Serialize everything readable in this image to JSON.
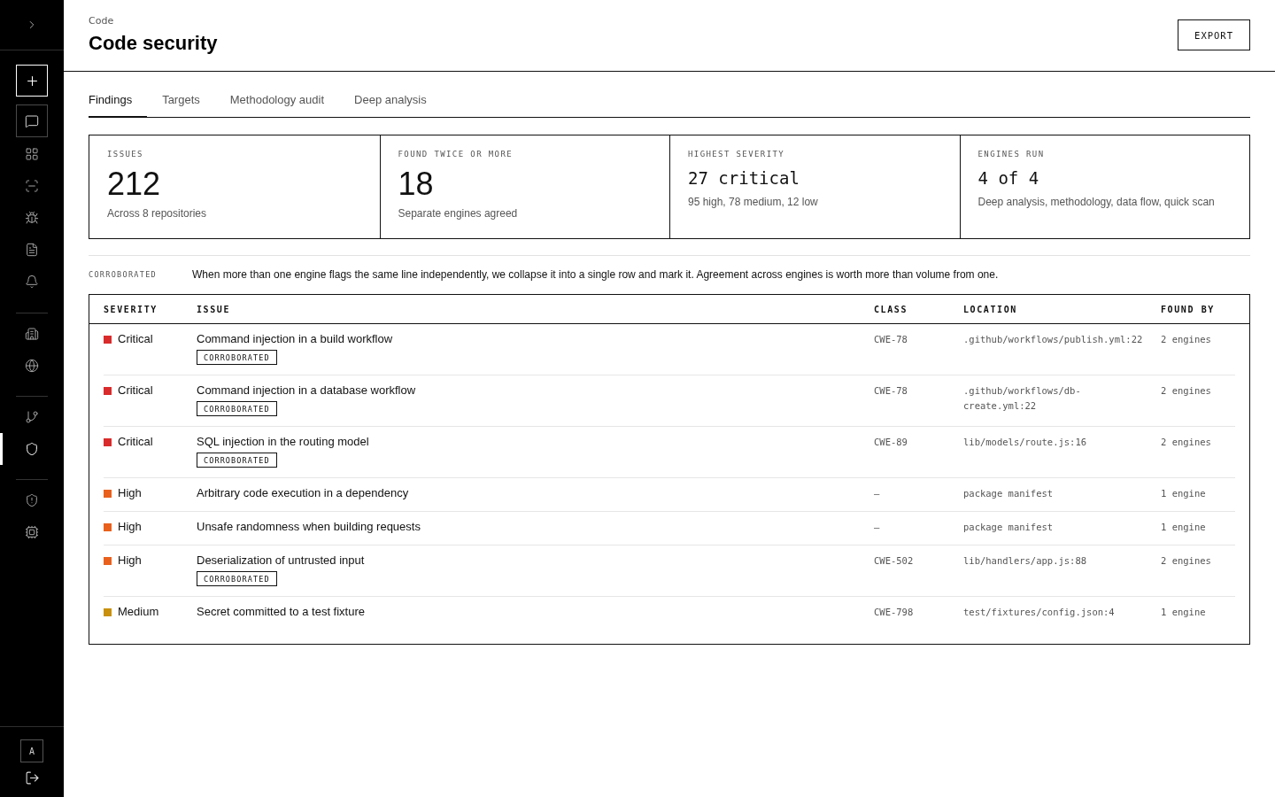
{
  "sidebar": {
    "groups": [
      {
        "items": [
          {
            "kind": "primary",
            "selected": false
          },
          {
            "kind": "framed",
            "selected": false
          },
          {
            "kind": "plain",
            "selected": false
          },
          {
            "kind": "plain",
            "selected": false
          },
          {
            "kind": "plain",
            "selected": false
          },
          {
            "kind": "plain",
            "selected": false
          },
          {
            "kind": "plain",
            "selected": false
          }
        ]
      },
      {
        "items": [
          {
            "kind": "plain",
            "selected": false
          },
          {
            "kind": "plain",
            "selected": false
          }
        ]
      },
      {
        "items": [
          {
            "kind": "plain",
            "selected": false
          },
          {
            "kind": "plain",
            "selected": true
          }
        ]
      },
      {
        "items": [
          {
            "kind": "plain",
            "selected": false
          },
          {
            "kind": "plain",
            "selected": false
          }
        ]
      }
    ],
    "avatar": {
      "initial": "A"
    }
  },
  "header": {
    "breadcrumb": "Code",
    "title": "Code security",
    "action": "EXPORT"
  },
  "tabs": [
    {
      "label": "Findings",
      "selected": true
    },
    {
      "label": "Targets",
      "selected": false
    },
    {
      "label": "Methodology audit",
      "selected": false
    },
    {
      "label": "Deep analysis",
      "selected": false
    }
  ],
  "stats": [
    {
      "kind": "number",
      "label": "ISSUES",
      "value": "212",
      "detail": "Across 8 repositories"
    },
    {
      "kind": "number",
      "label": "FOUND TWICE OR MORE",
      "value": "18",
      "detail": "Separate engines agreed"
    },
    {
      "kind": "phrase",
      "label": "HIGHEST SEVERITY",
      "value": "27 critical",
      "detail": "95 high, 78 medium, 12 low"
    },
    {
      "kind": "phrase",
      "label": "ENGINES RUN",
      "value": "4 of 4",
      "detail": "Deep analysis, methodology, data flow, quick scan"
    }
  ],
  "note": {
    "label": "CORROBORATED",
    "text": "When more than one engine flags the same line independently, we collapse it into a single row and mark it. Agreement across engines is worth more than volume from one."
  },
  "table": {
    "columns": [
      "SEVERITY",
      "ISSUE",
      "CLASS",
      "LOCATION",
      "FOUND BY"
    ],
    "rows": [
      {
        "severity": "Critical",
        "color": "#d92b2b",
        "issue": "Command injection in a build workflow",
        "badge": "CORROBORATED",
        "class": "CWE-78",
        "location": ".github/workflows/publish.yml:22",
        "found_by": "2 engines"
      },
      {
        "severity": "Critical",
        "color": "#d92b2b",
        "issue": "Command injection in a database workflow",
        "badge": "CORROBORATED",
        "class": "CWE-78",
        "location": ".github/workflows/db-create.yml:22",
        "found_by": "2 engines"
      },
      {
        "severity": "Critical",
        "color": "#d92b2b",
        "issue": "SQL injection in the routing model",
        "badge": "CORROBORATED",
        "class": "CWE-89",
        "location": "lib/models/route.js:16",
        "found_by": "2 engines"
      },
      {
        "severity": "High",
        "color": "#e8601c",
        "issue": "Arbitrary code execution in a dependency",
        "class": "—",
        "location": "package manifest",
        "found_by": "1 engine"
      },
      {
        "severity": "High",
        "color": "#e8601c",
        "issue": "Unsafe randomness when building requests",
        "class": "—",
        "location": "package manifest",
        "found_by": "1 engine"
      },
      {
        "severity": "High",
        "color": "#e8601c",
        "issue": "Deserialization of untrusted input",
        "badge": "CORROBORATED",
        "class": "CWE-502",
        "location": "lib/handlers/app.js:88",
        "found_by": "2 engines"
      },
      {
        "severity": "Medium",
        "color": "#c8900c",
        "issue": "Secret committed to a test fixture",
        "class": "CWE-798",
        "location": "test/fixtures/config.json:4",
        "found_by": "1 engine"
      }
    ]
  }
}
